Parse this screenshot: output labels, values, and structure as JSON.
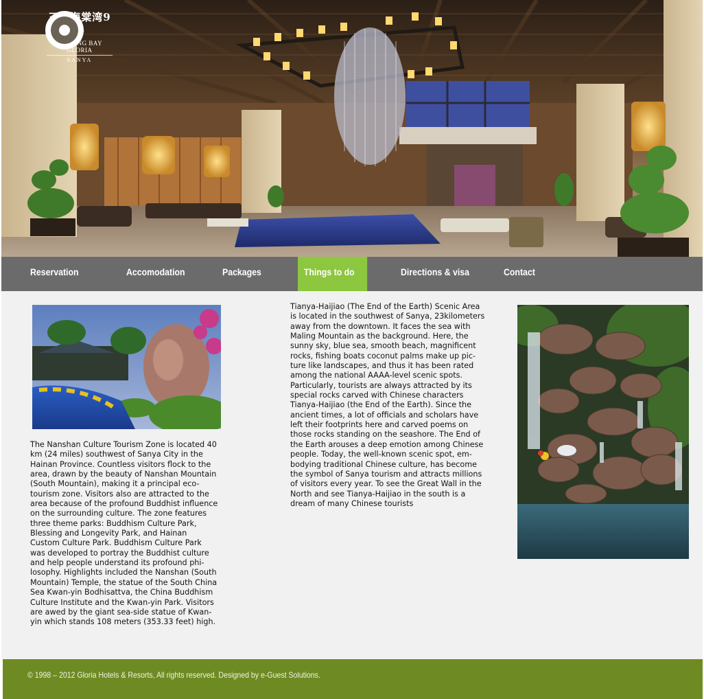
{
  "brand": {
    "name_cn": "三亚海棠湾9号",
    "name_en": "HAITANG BAY GLORIA",
    "city": "SANYA"
  },
  "nav": {
    "items": [
      {
        "label": "Reservation"
      },
      {
        "label": "Accomodation"
      },
      {
        "label": "Packages"
      },
      {
        "label": "Things to do"
      },
      {
        "label": "Directions & visa"
      },
      {
        "label": "Contact"
      }
    ],
    "active_color": "#8dc63f",
    "bar_color": "#6b6b6b"
  },
  "content": {
    "left_text": "The Nanshan Culture Tourism Zone is located 40\nkm (24 miles) southwest of Sanya City in the\nHainan Province. Countless visitors flock to the\narea, drawn by the beauty of Nanshan Mountain\n(South Mountain), making it a principal eco-\ntourism zone. Visitors also are attracted to the\narea because of the profound Buddhist influence\non the surrounding culture. The zone features\nthree theme parks: Buddhism Culture Park,\nBlessing and Longevity Park, and Hainan\nCustom Culture Park. Buddhism Culture Park\nwas developed to portray the Buddhist culture\nand help people understand its profound phi-\nlosophy. Highlights included the Nanshan (South\nMountain) Temple, the statue of the South China\nSea Kwan-yin Bodhisattva, the China Buddhism\nCulture Institute and the Kwan-yin Park. Visitors\nare awed by the giant sea-side statue of Kwan-\nyin which stands 108 meters (353.33 feet) high.",
    "middle_text": "Tianya-Haijiao (The End of the Earth) Scenic Area\nis located in the southwest of Sanya, 23kilometers\naway from the downtown. It faces the sea with\nMaling Mountain as the background. Here, the\nsunny sky, blue sea, smooth beach, magnificent\nrocks, fishing boats coconut palms make up pic-\nture like landscapes, and thus it has been rated\namong the national AAAA-level scenic spots.\nParticularly, tourists are always attracted by its\nspecial rocks carved with Chinese characters\nTianya-Haijiao (the End of the Earth). Since the\nancient times, a lot of officials and scholars have\nleft their footprints here and carved poems on\nthose rocks standing on the seashore. The End of\nthe Earth arouses a deep emotion among Chinese\npeople. Today, the well-known scenic spot, em-\nbodying traditional Chinese culture, has become\nthe symbol of Sanya tourism and attracts millions\nof visitors every year. To see the Great Wall in the\nNorth and see Tianya-Haijiao in the south is a\ndream of many Chinese tourists"
  },
  "footer": {
    "copyright": "© 1998 – 2012 Gloria Hotels & Resorts, All rights reserved. Designed by e-Guest Solutions.",
    "bg_color": "#6e8b23"
  }
}
